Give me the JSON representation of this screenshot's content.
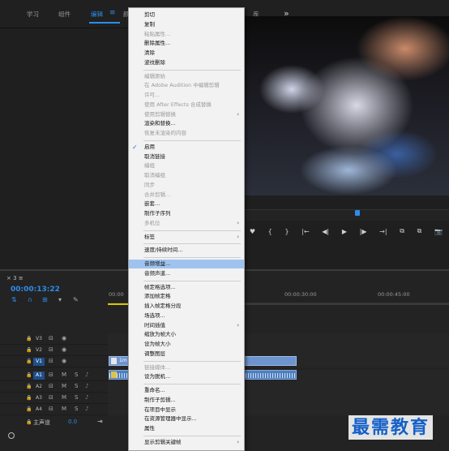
{
  "workspace": {
    "tabs": [
      "学习",
      "组件",
      "编辑",
      "颜",
      "库"
    ],
    "active_tab": "编辑",
    "menu_icon": "hamburger-icon",
    "overflow_label": "»"
  },
  "transport": [
    "♥",
    "{",
    "}",
    "|←",
    "◀|",
    "▶",
    "|▶",
    "→|",
    "⧉",
    "⧉",
    "📷"
  ],
  "timeline": {
    "tab_label": "× 3 ≡",
    "timecode": "00:00:13:22",
    "ruler": [
      "00:00",
      "00:00:30:00",
      "00:00:45:00"
    ],
    "tracks": [
      {
        "name": "V3",
        "type": "video"
      },
      {
        "name": "V2",
        "type": "video"
      },
      {
        "name": "V1",
        "type": "video",
        "selected": true
      },
      {
        "name": "A1",
        "type": "audio",
        "selected": true
      },
      {
        "name": "A2",
        "type": "audio"
      },
      {
        "name": "A3",
        "type": "audio"
      },
      {
        "name": "A4",
        "type": "audio"
      }
    ],
    "track_buttons": {
      "mute": "M",
      "solo": "S"
    },
    "clip_v1_label": "1m",
    "master_label": "主声道",
    "master_volume": "0.0"
  },
  "watermark": "最需教育",
  "context_menu": {
    "items": [
      {
        "label": "剪切",
        "enabled": true
      },
      {
        "label": "复制",
        "enabled": true
      },
      {
        "label": "粘贴属性...",
        "enabled": false
      },
      {
        "label": "删除属性...",
        "enabled": true
      },
      {
        "label": "清除",
        "enabled": true
      },
      {
        "label": "波纹删除",
        "enabled": true
      },
      {
        "sep": true
      },
      {
        "label": "编辑原始",
        "enabled": false
      },
      {
        "label": "在 Adobe Audition 中编辑剪辑",
        "enabled": false
      },
      {
        "label": "许可...",
        "enabled": false
      },
      {
        "label": "使用 After Effects 合成替换",
        "enabled": false
      },
      {
        "label": "使用剪辑替换",
        "enabled": false,
        "submenu": true
      },
      {
        "label": "渲染和替换...",
        "enabled": true
      },
      {
        "label": "恢复未渲染的内容",
        "enabled": false
      },
      {
        "sep": true
      },
      {
        "label": "启用",
        "enabled": true,
        "checked": true
      },
      {
        "label": "取消链接",
        "enabled": true
      },
      {
        "label": "编组",
        "enabled": false
      },
      {
        "label": "取消编组",
        "enabled": false
      },
      {
        "label": "同步",
        "enabled": false
      },
      {
        "label": "合并剪辑...",
        "enabled": false
      },
      {
        "label": "嵌套...",
        "enabled": true
      },
      {
        "label": "制作子序列",
        "enabled": true
      },
      {
        "label": "多机位",
        "enabled": false,
        "submenu": true
      },
      {
        "sep": true
      },
      {
        "label": "标签",
        "enabled": true,
        "submenu": true
      },
      {
        "sep": true
      },
      {
        "label": "速度/持续时间...",
        "enabled": true
      },
      {
        "sep": true
      },
      {
        "label": "音频增益...",
        "enabled": true,
        "highlighted": true
      },
      {
        "label": "音频声道...",
        "enabled": true
      },
      {
        "sep": true
      },
      {
        "label": "帧定格选项...",
        "enabled": true
      },
      {
        "label": "添加帧定格",
        "enabled": true
      },
      {
        "label": "插入帧定格分段",
        "enabled": true
      },
      {
        "label": "场选项...",
        "enabled": true
      },
      {
        "label": "时间插值",
        "enabled": true,
        "submenu": true
      },
      {
        "label": "缩放为帧大小",
        "enabled": true
      },
      {
        "label": "设为帧大小",
        "enabled": true
      },
      {
        "label": "调整图层",
        "enabled": true
      },
      {
        "sep": true
      },
      {
        "label": "链接媒体...",
        "enabled": false
      },
      {
        "label": "设为脱机...",
        "enabled": true
      },
      {
        "sep": true
      },
      {
        "label": "重命名...",
        "enabled": true
      },
      {
        "label": "制作子剪辑...",
        "enabled": true
      },
      {
        "label": "在项目中显示",
        "enabled": true
      },
      {
        "label": "在资源管理器中显示...",
        "enabled": true
      },
      {
        "label": "属性",
        "enabled": true
      },
      {
        "sep": true
      },
      {
        "label": "显示剪辑关键帧",
        "enabled": true,
        "submenu": true
      }
    ]
  }
}
